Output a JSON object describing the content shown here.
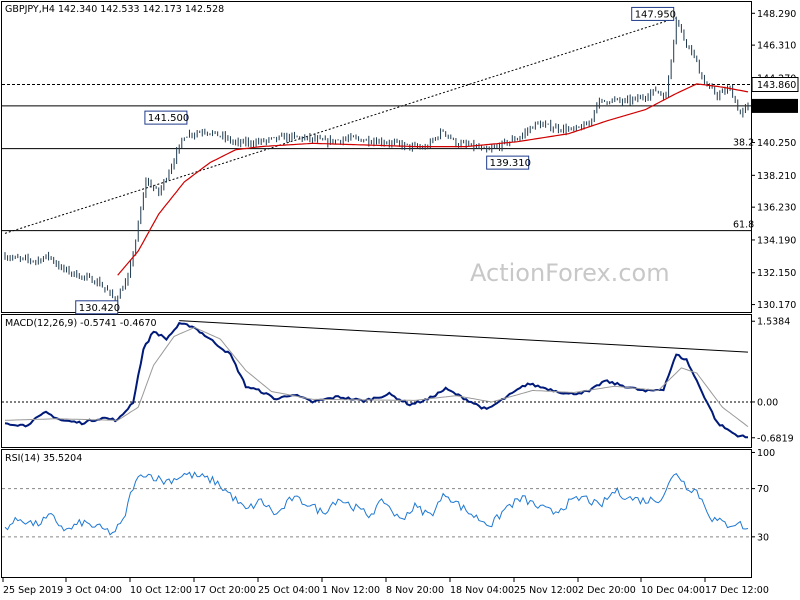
{
  "window": {
    "symbol_line": "GBPJPY,H4  142.340 142.533 142.173 142.528",
    "watermark": "ActionForex.com"
  },
  "colors": {
    "background": "#ffffff",
    "candles": "#1f3a4f",
    "ma": "#d00000",
    "macd": "#001a7a",
    "signal": "#9a9a9a",
    "rsi": "#1e78d2",
    "grid": "#000000"
  },
  "chart_data": [
    {
      "type": "line",
      "title": "GBPJPY,H4",
      "ohlc_header": {
        "open": 142.34,
        "high": 142.533,
        "low": 142.173,
        "close": 142.528
      },
      "ylim": [
        129.77,
        148.93
      ],
      "y_ticks": [
        "148.290",
        "146.310",
        "144.270",
        "142.528",
        "140.250",
        "138.210",
        "136.230",
        "134.190",
        "132.150",
        "130.170"
      ],
      "x_ticks": [
        "25 Sep 2019",
        "3 Oct 04:00",
        "10 Oct 12:00",
        "17 Oct 20:00",
        "25 Oct 04:00",
        "1 Nov 12:00",
        "8 Nov 20:00",
        "18 Nov 04:00",
        "25 Nov 12:00",
        "2 Dec 20:00",
        "10 Dec 04:00",
        "17 Dec 12:00"
      ],
      "price_anchors": [
        {
          "bar": 0,
          "v": 133.2
        },
        {
          "bar": 5,
          "v": 133.0
        },
        {
          "bar": 12,
          "v": 132.9
        },
        {
          "bar": 17,
          "v": 133.2
        },
        {
          "bar": 22,
          "v": 132.4
        },
        {
          "bar": 30,
          "v": 131.9
        },
        {
          "bar": 36,
          "v": 131.6
        },
        {
          "bar": 40,
          "v": 131.0
        },
        {
          "bar": 43,
          "v": 130.42
        },
        {
          "bar": 48,
          "v": 131.8
        },
        {
          "bar": 51,
          "v": 134.2
        },
        {
          "bar": 55,
          "v": 137.9
        },
        {
          "bar": 60,
          "v": 137.1
        },
        {
          "bar": 64,
          "v": 138.5
        },
        {
          "bar": 70,
          "v": 140.7
        },
        {
          "bar": 78,
          "v": 141.0
        },
        {
          "bar": 85,
          "v": 140.6
        },
        {
          "bar": 90,
          "v": 140.2
        },
        {
          "bar": 100,
          "v": 140.3
        },
        {
          "bar": 110,
          "v": 140.6
        },
        {
          "bar": 118,
          "v": 140.5
        },
        {
          "bar": 125,
          "v": 140.3
        },
        {
          "bar": 135,
          "v": 140.5
        },
        {
          "bar": 148,
          "v": 140.3
        },
        {
          "bar": 158,
          "v": 140.0
        },
        {
          "bar": 164,
          "v": 139.9
        },
        {
          "bar": 171,
          "v": 141.0
        },
        {
          "bar": 176,
          "v": 140.2
        },
        {
          "bar": 183,
          "v": 140.0
        },
        {
          "bar": 188,
          "v": 139.7
        },
        {
          "bar": 195,
          "v": 140.2
        },
        {
          "bar": 201,
          "v": 140.6
        },
        {
          "bar": 207,
          "v": 141.4
        },
        {
          "bar": 214,
          "v": 141.2
        },
        {
          "bar": 222,
          "v": 141.0
        },
        {
          "bar": 228,
          "v": 141.4
        },
        {
          "bar": 231,
          "v": 142.7
        },
        {
          "bar": 236,
          "v": 142.9
        },
        {
          "bar": 242,
          "v": 142.8
        },
        {
          "bar": 248,
          "v": 143.0
        },
        {
          "bar": 254,
          "v": 143.5
        },
        {
          "bar": 258,
          "v": 143.1
        },
        {
          "bar": 262,
          "v": 147.95
        },
        {
          "bar": 265,
          "v": 146.7
        },
        {
          "bar": 268,
          "v": 146.0
        },
        {
          "bar": 273,
          "v": 143.9
        },
        {
          "bar": 278,
          "v": 143.2
        },
        {
          "bar": 283,
          "v": 143.6
        },
        {
          "bar": 287,
          "v": 142.0
        },
        {
          "bar": 290,
          "v": 142.528
        }
      ],
      "ma_anchors": [
        {
          "bar": 44,
          "v": 132.0
        },
        {
          "bar": 52,
          "v": 133.5
        },
        {
          "bar": 60,
          "v": 135.8
        },
        {
          "bar": 70,
          "v": 137.8
        },
        {
          "bar": 80,
          "v": 139.0
        },
        {
          "bar": 90,
          "v": 139.8
        },
        {
          "bar": 100,
          "v": 140.0
        },
        {
          "bar": 120,
          "v": 140.2
        },
        {
          "bar": 140,
          "v": 140.1
        },
        {
          "bar": 160,
          "v": 140.0
        },
        {
          "bar": 180,
          "v": 140.0
        },
        {
          "bar": 200,
          "v": 140.3
        },
        {
          "bar": 220,
          "v": 140.8
        },
        {
          "bar": 235,
          "v": 141.6
        },
        {
          "bar": 250,
          "v": 142.3
        },
        {
          "bar": 262,
          "v": 143.3
        },
        {
          "bar": 270,
          "v": 143.9
        },
        {
          "bar": 280,
          "v": 143.7
        },
        {
          "bar": 290,
          "v": 143.4
        }
      ],
      "labels": [
        {
          "text": "147.950",
          "bar": 261,
          "v": 148.25,
          "side": "left"
        },
        {
          "text": "141.500",
          "bar": 71,
          "v": 141.8,
          "side": "left"
        },
        {
          "text": "139.310",
          "bar": 188,
          "v": 139.0,
          "side": "right"
        },
        {
          "text": "130.420",
          "bar": 44,
          "v": 130.0,
          "side": "left"
        }
      ],
      "horizontal_lines": [
        {
          "value": 143.86,
          "label": "143.860",
          "style": "dashed"
        },
        {
          "value": 142.528,
          "label": "142.528",
          "style": "solid"
        },
        {
          "value": 139.87,
          "label": "38.2",
          "style": "solid"
        },
        {
          "value": 134.77,
          "label": "61.8",
          "style": "solid"
        }
      ],
      "trendline": {
        "from": {
          "bar": 0,
          "v": 134.6
        },
        "to": {
          "bar": 262,
          "v": 148.0
        }
      }
    },
    {
      "type": "line",
      "title": "MACD(12,26,9) -0.5741 -0.4670",
      "ylim": [
        -0.82,
        1.6
      ],
      "y_ticks": [
        "1.5384",
        "0.00",
        "-0.6819"
      ],
      "series": [
        {
          "key": "macd",
          "anchors": [
            {
              "bar": 0,
              "v": -0.4
            },
            {
              "bar": 8,
              "v": -0.45
            },
            {
              "bar": 16,
              "v": -0.2
            },
            {
              "bar": 22,
              "v": -0.35
            },
            {
              "bar": 30,
              "v": -0.4
            },
            {
              "bar": 38,
              "v": -0.3
            },
            {
              "bar": 44,
              "v": -0.35
            },
            {
              "bar": 50,
              "v": 0.0
            },
            {
              "bar": 54,
              "v": 1.0
            },
            {
              "bar": 58,
              "v": 1.35
            },
            {
              "bar": 63,
              "v": 1.2
            },
            {
              "bar": 68,
              "v": 1.48
            },
            {
              "bar": 73,
              "v": 1.45
            },
            {
              "bar": 80,
              "v": 1.2
            },
            {
              "bar": 88,
              "v": 0.9
            },
            {
              "bar": 94,
              "v": 0.3
            },
            {
              "bar": 100,
              "v": 0.2
            },
            {
              "bar": 106,
              "v": 0.05
            },
            {
              "bar": 112,
              "v": 0.15
            },
            {
              "bar": 120,
              "v": 0.0
            },
            {
              "bar": 130,
              "v": 0.1
            },
            {
              "bar": 140,
              "v": 0.02
            },
            {
              "bar": 150,
              "v": 0.15
            },
            {
              "bar": 158,
              "v": -0.05
            },
            {
              "bar": 165,
              "v": 0.05
            },
            {
              "bar": 172,
              "v": 0.25
            },
            {
              "bar": 180,
              "v": 0.05
            },
            {
              "bar": 188,
              "v": -0.15
            },
            {
              "bar": 196,
              "v": 0.1
            },
            {
              "bar": 204,
              "v": 0.35
            },
            {
              "bar": 212,
              "v": 0.25
            },
            {
              "bar": 220,
              "v": 0.15
            },
            {
              "bar": 228,
              "v": 0.2
            },
            {
              "bar": 234,
              "v": 0.4
            },
            {
              "bar": 242,
              "v": 0.3
            },
            {
              "bar": 250,
              "v": 0.2
            },
            {
              "bar": 257,
              "v": 0.25
            },
            {
              "bar": 262,
              "v": 0.9
            },
            {
              "bar": 266,
              "v": 0.8
            },
            {
              "bar": 272,
              "v": 0.2
            },
            {
              "bar": 278,
              "v": -0.4
            },
            {
              "bar": 285,
              "v": -0.62
            },
            {
              "bar": 290,
              "v": -0.6819
            }
          ]
        },
        {
          "key": "signal",
          "anchors": [
            {
              "bar": 0,
              "v": -0.35
            },
            {
              "bar": 20,
              "v": -0.32
            },
            {
              "bar": 44,
              "v": -0.35
            },
            {
              "bar": 52,
              "v": -0.1
            },
            {
              "bar": 58,
              "v": 0.7
            },
            {
              "bar": 66,
              "v": 1.25
            },
            {
              "bar": 74,
              "v": 1.42
            },
            {
              "bar": 84,
              "v": 1.2
            },
            {
              "bar": 94,
              "v": 0.6
            },
            {
              "bar": 104,
              "v": 0.2
            },
            {
              "bar": 120,
              "v": 0.05
            },
            {
              "bar": 140,
              "v": 0.04
            },
            {
              "bar": 160,
              "v": 0.03
            },
            {
              "bar": 176,
              "v": 0.12
            },
            {
              "bar": 190,
              "v": 0.0
            },
            {
              "bar": 206,
              "v": 0.22
            },
            {
              "bar": 222,
              "v": 0.18
            },
            {
              "bar": 238,
              "v": 0.3
            },
            {
              "bar": 255,
              "v": 0.22
            },
            {
              "bar": 264,
              "v": 0.65
            },
            {
              "bar": 270,
              "v": 0.55
            },
            {
              "bar": 280,
              "v": -0.1
            },
            {
              "bar": 290,
              "v": -0.47
            }
          ]
        }
      ],
      "trendline": {
        "from": {
          "bar": 68,
          "v": 1.55
        },
        "to": {
          "bar": 290,
          "v": 0.95
        }
      }
    },
    {
      "type": "line",
      "title": "RSI(14) 35.5204",
      "ylim": [
        0,
        100
      ],
      "y_ticks": [
        "100",
        "70",
        "30"
      ],
      "series": [
        {
          "key": "rsi",
          "anchors": [
            {
              "bar": 0,
              "v": 38
            },
            {
              "bar": 6,
              "v": 45
            },
            {
              "bar": 12,
              "v": 40
            },
            {
              "bar": 18,
              "v": 47
            },
            {
              "bar": 24,
              "v": 35
            },
            {
              "bar": 30,
              "v": 42
            },
            {
              "bar": 36,
              "v": 38
            },
            {
              "bar": 42,
              "v": 33
            },
            {
              "bar": 46,
              "v": 42
            },
            {
              "bar": 50,
              "v": 72
            },
            {
              "bar": 54,
              "v": 83
            },
            {
              "bar": 58,
              "v": 80
            },
            {
              "bar": 62,
              "v": 76
            },
            {
              "bar": 66,
              "v": 78
            },
            {
              "bar": 70,
              "v": 82
            },
            {
              "bar": 76,
              "v": 80
            },
            {
              "bar": 82,
              "v": 76
            },
            {
              "bar": 88,
              "v": 65
            },
            {
              "bar": 94,
              "v": 52
            },
            {
              "bar": 100,
              "v": 60
            },
            {
              "bar": 106,
              "v": 48
            },
            {
              "bar": 112,
              "v": 62
            },
            {
              "bar": 118,
              "v": 58
            },
            {
              "bar": 124,
              "v": 50
            },
            {
              "bar": 130,
              "v": 62
            },
            {
              "bar": 136,
              "v": 55
            },
            {
              "bar": 142,
              "v": 48
            },
            {
              "bar": 148,
              "v": 60
            },
            {
              "bar": 154,
              "v": 44
            },
            {
              "bar": 160,
              "v": 55
            },
            {
              "bar": 166,
              "v": 48
            },
            {
              "bar": 172,
              "v": 66
            },
            {
              "bar": 178,
              "v": 55
            },
            {
              "bar": 184,
              "v": 46
            },
            {
              "bar": 190,
              "v": 40
            },
            {
              "bar": 196,
              "v": 55
            },
            {
              "bar": 202,
              "v": 62
            },
            {
              "bar": 208,
              "v": 55
            },
            {
              "bar": 214,
              "v": 50
            },
            {
              "bar": 220,
              "v": 58
            },
            {
              "bar": 226,
              "v": 63
            },
            {
              "bar": 232,
              "v": 55
            },
            {
              "bar": 238,
              "v": 68
            },
            {
              "bar": 244,
              "v": 62
            },
            {
              "bar": 250,
              "v": 60
            },
            {
              "bar": 256,
              "v": 62
            },
            {
              "bar": 262,
              "v": 84
            },
            {
              "bar": 266,
              "v": 72
            },
            {
              "bar": 270,
              "v": 68
            },
            {
              "bar": 276,
              "v": 45
            },
            {
              "bar": 282,
              "v": 40
            },
            {
              "bar": 286,
              "v": 42
            },
            {
              "bar": 290,
              "v": 35.5
            }
          ]
        }
      ],
      "levels": [
        70,
        30
      ]
    }
  ]
}
